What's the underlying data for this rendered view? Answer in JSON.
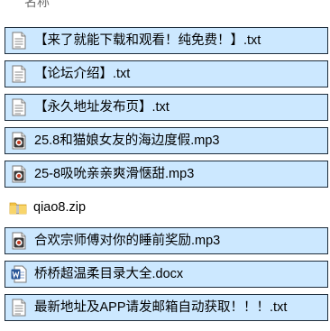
{
  "header": {
    "name_column": "名称"
  },
  "files": [
    {
      "name": "【来了就能下载和观看！纯免费！】.txt",
      "type": "txt",
      "selected": true
    },
    {
      "name": "【论坛介绍】.txt",
      "type": "txt",
      "selected": true
    },
    {
      "name": "【永久地址发布页】.txt",
      "type": "txt",
      "selected": true
    },
    {
      "name": "25.8和猫娘女友的海边度假.mp3",
      "type": "mp3",
      "selected": true
    },
    {
      "name": "25-8吸吮亲亲爽滑惬甜.mp3",
      "type": "mp3",
      "selected": true
    },
    {
      "name": "qiao8.zip",
      "type": "zip",
      "selected": false
    },
    {
      "name": "合欢宗师傅对你的睡前奖励.mp3",
      "type": "mp3",
      "selected": true
    },
    {
      "name": "桥桥超温柔目录大全.docx",
      "type": "docx",
      "selected": true
    },
    {
      "name": "最新地址及APP请发邮箱自动获取！！！.txt",
      "type": "txt",
      "selected": true
    }
  ],
  "colors": {
    "selection_bg": "#cce8ff",
    "selection_border": "#1e2d3b",
    "folder_yellow": "#f3c244",
    "word_blue": "#2b5797",
    "media_red": "#c23b22"
  }
}
